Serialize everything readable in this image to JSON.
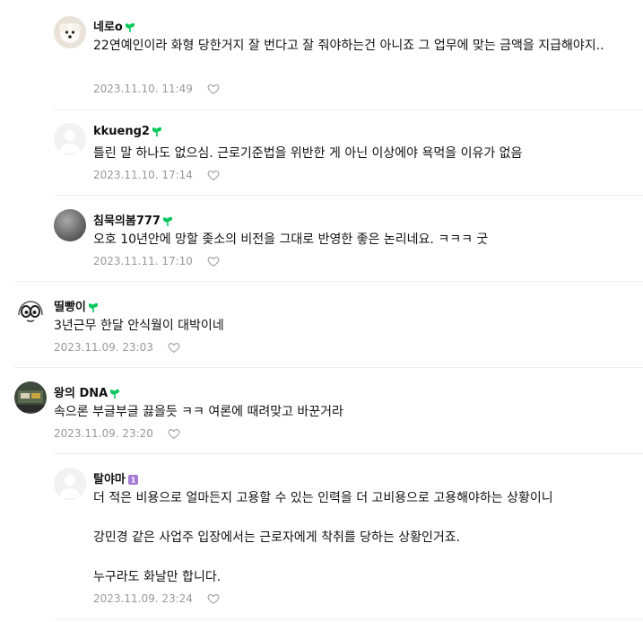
{
  "comments": [
    {
      "nick": "네로o",
      "badge": "sprout-icon",
      "text": "22연예인이라 화형 당한거지 잘 번다고 잘 줘야하는건 아니죠 그 업무에 맞는 금액을 지급해야지..",
      "date": "2023.11.10. 11:49"
    },
    {
      "nick": "kkueng2",
      "badge": "sprout-icon",
      "text": "틀린 말 하나도 없으심. 근로기준법을 위반한 게 아닌 이상에야 욕먹을 이유가 없음",
      "date": "2023.11.10. 17:14"
    },
    {
      "nick": "침묵의봄777",
      "badge": "sprout-icon",
      "text": "오호 10년안에 망할 좆소의 비전을 그대로 반영한 좋은 논리네요. ㅋㅋㅋ 굿",
      "date": "2023.11.11. 17:10"
    },
    {
      "nick": "띨빵이",
      "badge": "sprout-icon",
      "text": "3년근무 한달 안식월이 대박이네",
      "date": "2023.11.09. 23:03"
    },
    {
      "nick": "왕의 DNA",
      "badge": "sprout-icon",
      "text": "속으론 부글부글 끓을듯 ㅋㅋ 여론에 때려맞고 바꾼거라",
      "date": "2023.11.09. 23:20"
    },
    {
      "nick": "탈야마",
      "badge": "level-1-badge",
      "text": "더 적은 비용으로 얼마든지 고용할 수 있는 인력을 더 고비용으로 고용해야하는 상황이니\n\n강민경 같은 사업주 입장에서는 근로자에게 착취를 당하는 상황인거죠.\n\n누구라도 화날만 합니다.",
      "date": "2023.11.09. 23:24"
    }
  ],
  "colors": {
    "sprout": "#03c75a",
    "level_badge": "#a57bd8",
    "date": "#999999"
  }
}
